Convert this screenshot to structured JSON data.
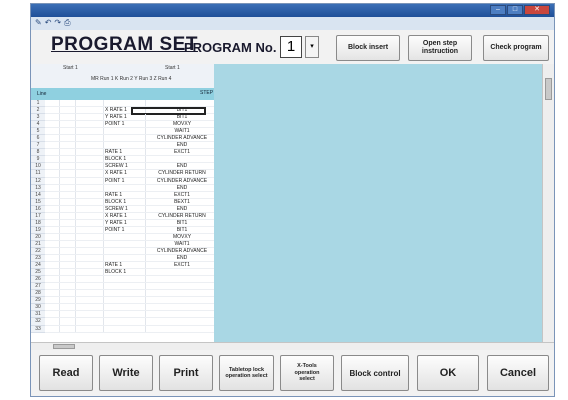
{
  "window": {
    "title": "",
    "controls": {
      "minimize": "–",
      "maximize": "□",
      "close": "✕"
    }
  },
  "quick_access": [
    "✎",
    "↶",
    "↷",
    "⎙"
  ],
  "header": {
    "title": "PROGRAM SET",
    "program_no_label": "PROGRAM No.",
    "program_no_value": "1",
    "program_no_dropdown": "▾"
  },
  "toolbar_buttons": {
    "block_insert": "Block insert",
    "open_step_instruction": "Open step\ninstruction",
    "check_program": "Check program"
  },
  "sheet": {
    "col_header_1": "Start 1",
    "col_header_2": "Start 1",
    "col_header_3": "MR Run 1 K Run 2 Y Run 3 Z Run 4",
    "header_band_left": "Line",
    "header_band_right": "STEP",
    "rows": [
      {
        "n": "1",
        "label": "",
        "value": ""
      },
      {
        "n": "2",
        "label": "X RATE 1",
        "value": "BIT1"
      },
      {
        "n": "3",
        "label": "Y RATE 1",
        "value": "BIT1"
      },
      {
        "n": "4",
        "label": "POINT 1",
        "value": "MOVXY"
      },
      {
        "n": "5",
        "label": "",
        "value": "WAIT1"
      },
      {
        "n": "6",
        "label": "",
        "value": "CYLINDER ADVANCE"
      },
      {
        "n": "7",
        "label": "",
        "value": "END"
      },
      {
        "n": "8",
        "label": "RATE 1",
        "value": "EXCT1"
      },
      {
        "n": "9",
        "label": "BLOCK 1",
        "value": ""
      },
      {
        "n": "10",
        "label": "SCREW 1",
        "value": "END"
      },
      {
        "n": "11",
        "label": "X RATE 1",
        "value": "CYLINDER RETURN"
      },
      {
        "n": "12",
        "label": "POINT 1",
        "value": "CYLINDER ADVANCE"
      },
      {
        "n": "13",
        "label": "",
        "value": "END"
      },
      {
        "n": "14",
        "label": "RATE 1",
        "value": "EXCT1"
      },
      {
        "n": "15",
        "label": "BLOCK 1",
        "value": "BEXT1"
      },
      {
        "n": "16",
        "label": "SCREW 1",
        "value": "END"
      },
      {
        "n": "17",
        "label": "X RATE 1",
        "value": "CYLINDER RETURN"
      },
      {
        "n": "18",
        "label": "Y RATE 1",
        "value": "BIT1"
      },
      {
        "n": "19",
        "label": "POINT 1",
        "value": "BIT1"
      },
      {
        "n": "20",
        "label": "",
        "value": "MOVXY"
      },
      {
        "n": "21",
        "label": "",
        "value": "WAIT1"
      },
      {
        "n": "22",
        "label": "",
        "value": "CYLINDER ADVANCE"
      },
      {
        "n": "23",
        "label": "",
        "value": "END"
      },
      {
        "n": "24",
        "label": "RATE 1",
        "value": "EXCT1"
      },
      {
        "n": "25",
        "label": "BLOCK 1",
        "value": ""
      },
      {
        "n": "26",
        "label": "",
        "value": ""
      },
      {
        "n": "27",
        "label": "",
        "value": ""
      },
      {
        "n": "28",
        "label": "",
        "value": ""
      },
      {
        "n": "29",
        "label": "",
        "value": ""
      },
      {
        "n": "30",
        "label": "",
        "value": ""
      },
      {
        "n": "31",
        "label": "",
        "value": ""
      },
      {
        "n": "32",
        "label": "",
        "value": ""
      },
      {
        "n": "33",
        "label": "",
        "value": ""
      }
    ]
  },
  "bottom_buttons": {
    "read": "Read",
    "write": "Write",
    "print": "Print",
    "tabletop_lock": "Tabletop lock\noperation select",
    "x_tools": "X-Tools\noperation\nselect",
    "block_control": "Block control",
    "ok": "OK",
    "cancel": "Cancel"
  },
  "colors": {
    "work_area": "#a9d7e4",
    "header_band": "#8fd0e0",
    "marker": "#8cc975"
  }
}
